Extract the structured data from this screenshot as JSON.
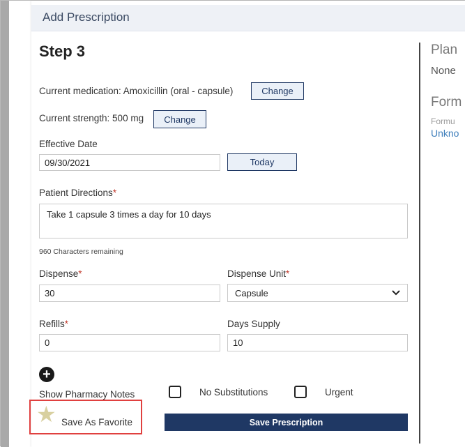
{
  "header": {
    "title": "Add Prescription"
  },
  "step": {
    "title": "Step 3"
  },
  "medication": {
    "label": "Current medication: Amoxicillin (oral - capsule)",
    "change_label": "Change"
  },
  "strength": {
    "label": "Current strength: 500 mg",
    "change_label": "Change"
  },
  "effective_date": {
    "label": "Effective Date",
    "value": "09/30/2021",
    "today_label": "Today"
  },
  "directions": {
    "label": "Patient Directions",
    "required_mark": "*",
    "value": "Take 1 capsule 3 times a day for 10 days",
    "remaining": "960 Characters remaining"
  },
  "dispense": {
    "label": "Dispense",
    "required_mark": "*",
    "value": "30"
  },
  "dispense_unit": {
    "label": "Dispense Unit",
    "required_mark": "*",
    "selected": "Capsule"
  },
  "refills": {
    "label": "Refills",
    "required_mark": "*",
    "value": "0"
  },
  "days_supply": {
    "label": "Days Supply",
    "value": "10"
  },
  "pharmacy_notes": {
    "label": "Show Pharmacy Notes"
  },
  "options": {
    "no_substitutions": "No Substitutions",
    "urgent": "Urgent"
  },
  "favorite": {
    "label": "Save As Favorite"
  },
  "save": {
    "label": "Save Prescription"
  },
  "right_panel": {
    "plan_heading": "Plan",
    "plan_value": "None",
    "formulary_heading": "Form",
    "formulary_sub": "Formu",
    "formulary_link": "Unkno"
  },
  "colors": {
    "primary": "#1f3864",
    "highlight_border": "#e0403f",
    "required": "#c0392b",
    "link": "#3d7ebb"
  },
  "icons": {
    "add": "plus-circle-icon",
    "favorite": "star-icon",
    "dropdown": "chevron-down-icon"
  }
}
